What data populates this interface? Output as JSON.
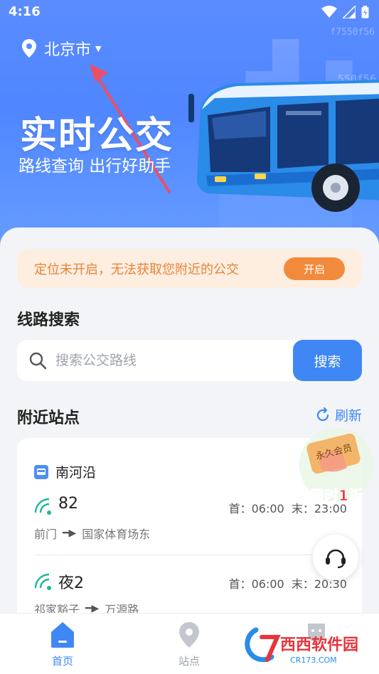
{
  "statusbar": {
    "time": "4:16"
  },
  "watermarks": {
    "w1": "f7550f56",
    "w2": "550f56"
  },
  "header": {
    "city": "北京市",
    "title": "实时公交",
    "subtitle": "路线查询 出行好助手"
  },
  "alert": {
    "text": "定位未开启，无法获取您附近的公交",
    "button": "开启"
  },
  "route_search": {
    "title": "线路搜索",
    "placeholder": "搜索公交路线",
    "button": "搜索"
  },
  "nearby": {
    "title": "附近站点",
    "refresh": "刷新",
    "stop_name": "南河沿",
    "routes": [
      {
        "number": "82",
        "first": "首：06:00",
        "last": "末：23:00",
        "from": "前门",
        "to": "国家体育场东"
      },
      {
        "number": "夜2",
        "first": "首：06:00",
        "last": "末：20:30",
        "from": "祁家豁子",
        "to": "万源路"
      }
    ]
  },
  "promo": {
    "badge": "永久会员",
    "text": "限时1折"
  },
  "bottom_nav": {
    "home": "首页",
    "stops": "站点"
  },
  "site_logo": {
    "text": "西西软件园",
    "sub": "CR173.COM"
  },
  "colors": {
    "primary": "#3f87f5",
    "header": "#5b8cff",
    "alert_bg": "#fdeee0",
    "alert_accent": "#f28a3c"
  }
}
